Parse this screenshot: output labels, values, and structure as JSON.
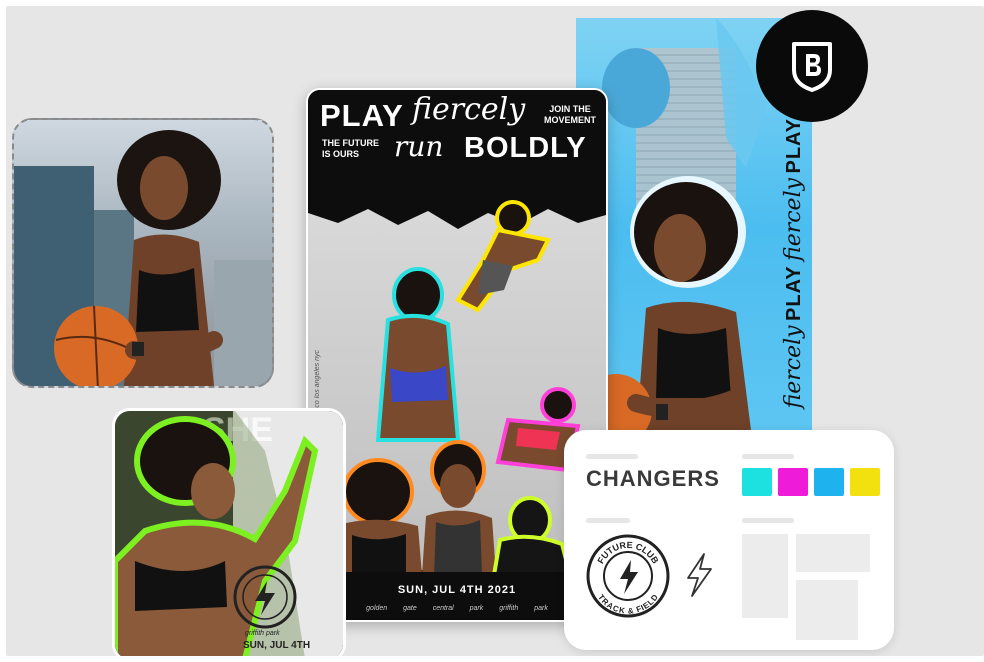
{
  "poster": {
    "play": "PLAY",
    "fiercely": "fiercely",
    "join_line1": "JOIN THE",
    "join_line2": "MOVEMENT",
    "future_line1": "THE FUTURE",
    "future_line2": "IS OURS",
    "run": "run",
    "boldly": "BOLDLY",
    "date": "SUN, JUL 4TH 2021",
    "locations": "golden gate   central park   griffith park",
    "side_text": "san francisco   los angeles   nyc"
  },
  "blue_poster": {
    "play": "PLAY",
    "fiercely": "fiercely"
  },
  "green_poster": {
    "bg_text": "SHE",
    "subtitle": "griffith park",
    "date": "SUN, JUL 4TH"
  },
  "brand_panel": {
    "title": "CHANGERS",
    "badge_top": "FUTURE CLUB",
    "badge_bottom": "TRACK & FIELD",
    "colors": [
      "#1de0e0",
      "#ee1bd8",
      "#1eb3ee",
      "#f3e10f"
    ]
  },
  "logo": {
    "icon": "brand-b-shield-icon"
  }
}
